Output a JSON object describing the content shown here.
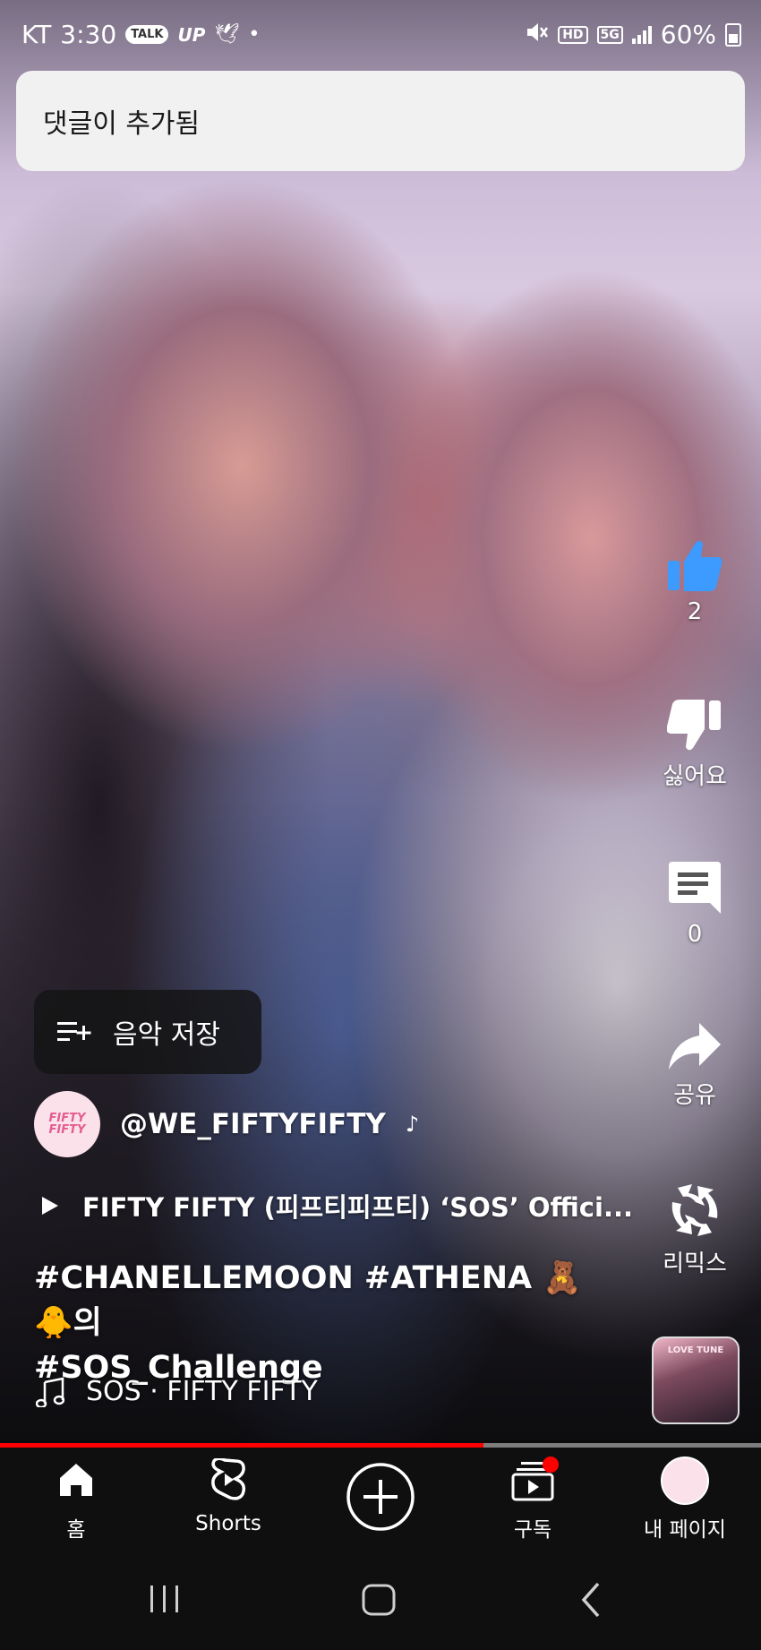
{
  "status_bar": {
    "carrier": "KT",
    "time": "3:30",
    "talk_badge": "TALK",
    "up_text": "UP",
    "hd_badge": "HD",
    "network": "5G",
    "battery": "60%"
  },
  "toast": {
    "message": "댓글이 추가됨"
  },
  "actions": {
    "like_count": "2",
    "dislike_label": "싫어요",
    "comment_count": "0",
    "share_label": "공유",
    "remix_label": "리믹스"
  },
  "save_music": {
    "label": "음악 저장"
  },
  "channel": {
    "avatar_text_line1": "FIFTY",
    "avatar_text_line2": "FIFTY",
    "handle": "@WE_FIFTYFIFTY"
  },
  "linked_video": {
    "title": "FIFTY FIFTY (피프티피프티) ‘SOS’ Offici..."
  },
  "caption": {
    "line1": "#CHANELLEMOON #ATHENA 🧸🐥의",
    "line2": "#SOS_Challenge"
  },
  "sound": {
    "label": "SOS · FIFTY FIFTY",
    "thumb_text": "LOVE TUNE"
  },
  "progress": {
    "played_fraction": 0.635
  },
  "bottom_nav": {
    "home": "홈",
    "shorts": "Shorts",
    "subscriptions": "구독",
    "my_page": "내 페이지"
  },
  "colors": {
    "like_blue": "#3d9bff",
    "progress_red": "#ff0000",
    "notification_dot": "#ff0000",
    "nav_background": "#0f0f0f",
    "toast_background": "#f1f1f1"
  }
}
